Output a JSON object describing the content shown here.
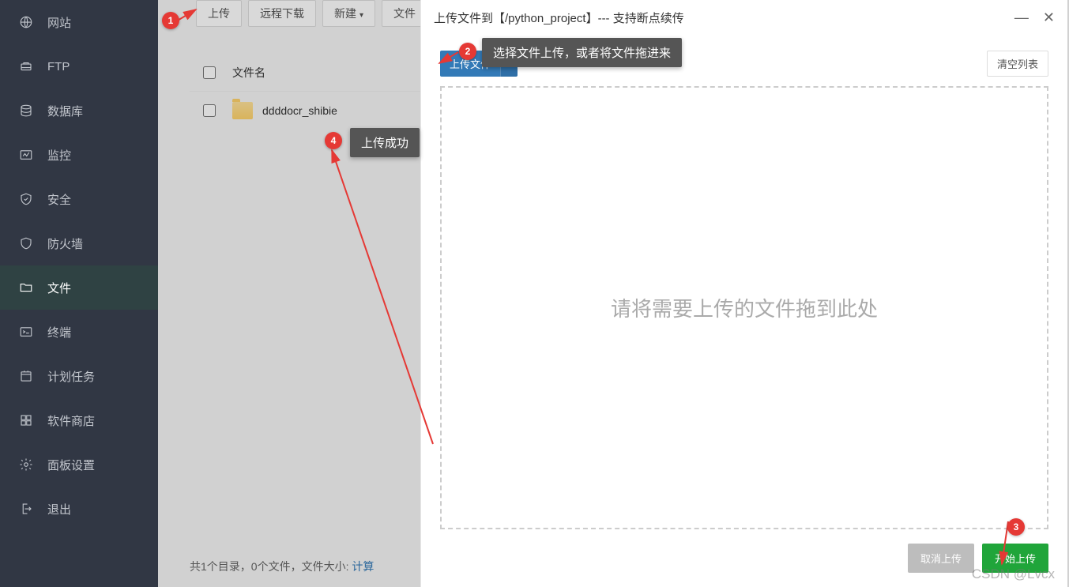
{
  "sidebar": {
    "items": [
      {
        "label": "网站",
        "icon": "globe-icon"
      },
      {
        "label": "FTP",
        "icon": "ftp-icon"
      },
      {
        "label": "数据库",
        "icon": "database-icon"
      },
      {
        "label": "监控",
        "icon": "monitor-icon"
      },
      {
        "label": "安全",
        "icon": "shield-icon"
      },
      {
        "label": "防火墙",
        "icon": "firewall-icon"
      },
      {
        "label": "文件",
        "icon": "folder-icon",
        "active": true
      },
      {
        "label": "终端",
        "icon": "terminal-icon"
      },
      {
        "label": "计划任务",
        "icon": "task-icon"
      },
      {
        "label": "软件商店",
        "icon": "appstore-icon"
      },
      {
        "label": "面板设置",
        "icon": "settings-icon"
      },
      {
        "label": "退出",
        "icon": "logout-icon"
      }
    ]
  },
  "toolbar": {
    "upload": "上传",
    "remote_download": "远程下载",
    "new": "新建",
    "file": "文件"
  },
  "table": {
    "header_filename": "文件名",
    "rows": [
      {
        "name": "ddddocr_shibie"
      }
    ]
  },
  "footer": {
    "text_prefix": "共1个目录，0个文件，文件大小: ",
    "calc": "计算"
  },
  "modal": {
    "title": "上传文件到【/python_project】--- 支持断点续传",
    "upload_file": "上传文件",
    "clear_list": "清空列表",
    "drop_text": "请将需要上传的文件拖到此处",
    "cancel": "取消上传",
    "start": "开始上传"
  },
  "annotations": {
    "b1": "1",
    "b2": "2",
    "b3": "3",
    "b4": "4",
    "tooltip2": "选择文件上传，或者将文件拖进来",
    "tooltip4": "上传成功"
  },
  "watermark": "CSDN @Lvcx"
}
